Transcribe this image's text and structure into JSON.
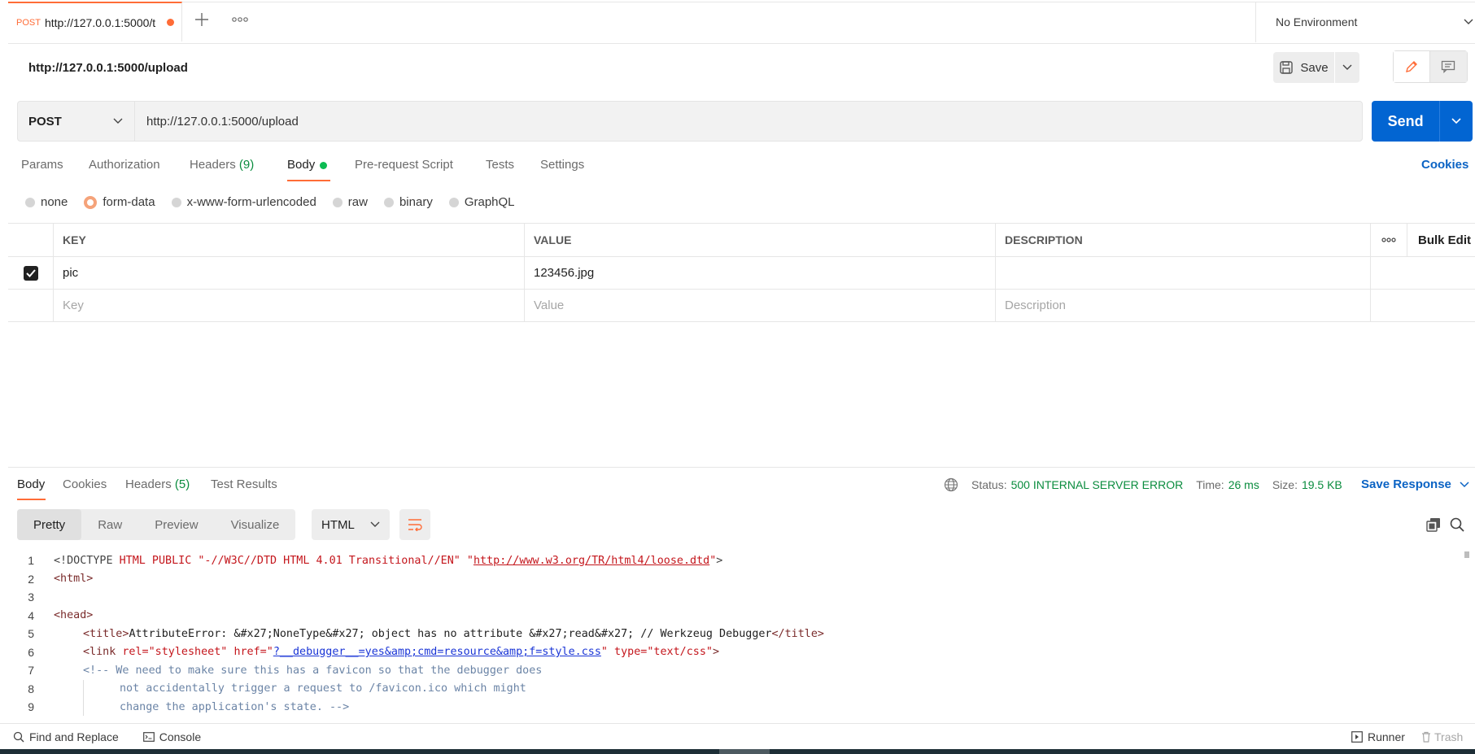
{
  "tab": {
    "method": "POST",
    "url": "http://127.0.0.1:5000/t"
  },
  "environment": {
    "label": "No Environment"
  },
  "request": {
    "title": "http://127.0.0.1:5000/upload",
    "save_label": "Save",
    "method": "POST",
    "url": "http://127.0.0.1:5000/upload",
    "send_label": "Send"
  },
  "request_tabs": {
    "params": "Params",
    "authorization": "Authorization",
    "headers": "Headers",
    "headers_count": "(9)",
    "body": "Body",
    "pre_request": "Pre-request Script",
    "tests": "Tests",
    "settings": "Settings",
    "cookies": "Cookies"
  },
  "body_types": [
    "none",
    "form-data",
    "x-www-form-urlencoded",
    "raw",
    "binary",
    "GraphQL"
  ],
  "body_type_selected": "form-data",
  "table": {
    "headers": {
      "key": "KEY",
      "value": "VALUE",
      "description": "DESCRIPTION",
      "bulk_edit": "Bulk Edit"
    },
    "rows": [
      {
        "key": "pic",
        "value": "123456.jpg",
        "description": "",
        "checked": true
      }
    ],
    "placeholders": {
      "key": "Key",
      "value": "Value",
      "description": "Description"
    }
  },
  "response": {
    "tabs": {
      "body": "Body",
      "cookies": "Cookies",
      "headers": "Headers",
      "headers_count": "(5)",
      "test_results": "Test Results"
    },
    "status_label": "Status:",
    "status_value": "500 INTERNAL SERVER ERROR",
    "time_label": "Time:",
    "time_value": "26 ms",
    "size_label": "Size:",
    "size_value": "19.5 KB",
    "save_response": "Save Response",
    "views": [
      "Pretty",
      "Raw",
      "Preview",
      "Visualize"
    ],
    "language": "HTML"
  },
  "code": {
    "l1_a": "<!DOCTYPE ",
    "l1_b": "HTML PUBLIC ",
    "l1_c": "\"-//W3C//DTD HTML 4.01 Transitional//EN\" \"",
    "l1_d": "http://www.w3.org/TR/html4/loose.dtd",
    "l1_e": "\"",
    "l1_f": ">",
    "l2": "<html>",
    "l4": "<head>",
    "l5_a": "<title>",
    "l5_b": "AttributeError: &#x27;NoneType&#x27; object has no attribute &#x27;read&#x27; // Werkzeug Debugger",
    "l5_c": "</title>",
    "l6_a": "<link ",
    "l6_b": "rel=",
    "l6_c": "\"stylesheet\" ",
    "l6_d": "href=",
    "l6_e": "\"",
    "l6_f": "?__debugger__=yes&amp;cmd=resource&amp;f=style.css",
    "l6_g": "\" ",
    "l6_h": "type=",
    "l6_i": "\"text/css\"",
    "l6_j": ">",
    "l7": "<!-- We need to make sure this has a favicon so that the debugger does",
    "l8": "not accidentally trigger a request to /favicon.ico which might",
    "l9": "change the application's state. -->"
  },
  "footer": {
    "find_replace": "Find and Replace",
    "console": "Console",
    "runner": "Runner",
    "trash": "Trash"
  },
  "colors": {
    "accent": "#ff6c37",
    "send": "#0265d2",
    "status_ok": "#0a8c3e",
    "link": "#0b63c4"
  }
}
